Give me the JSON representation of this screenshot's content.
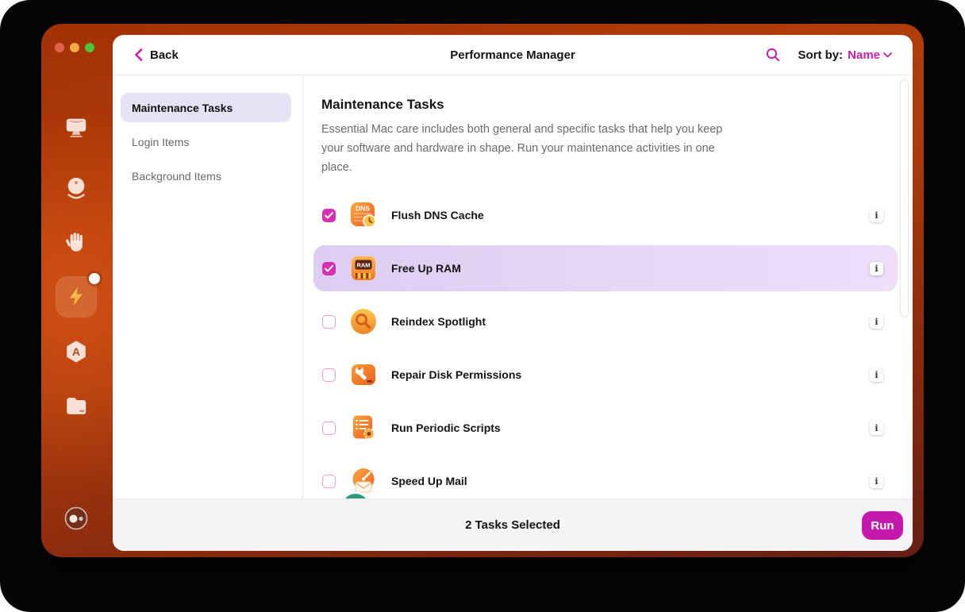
{
  "window": {
    "header": {
      "back_label": "Back",
      "title": "Performance Manager",
      "sort_by_label": "Sort by:",
      "sort_value": "Name"
    }
  },
  "sidebar": {
    "icons": [
      {
        "name": "cleanup-display-icon"
      },
      {
        "name": "smart-care-orb-icon"
      },
      {
        "name": "protection-hand-icon"
      },
      {
        "name": "performance-bolt-icon",
        "active": true,
        "has_notification": true
      },
      {
        "name": "applications-icon"
      },
      {
        "name": "my-clutter-folder-icon"
      },
      {
        "name": "assistant-icon"
      }
    ]
  },
  "nav": {
    "items": [
      {
        "label": "Maintenance Tasks",
        "active": true
      },
      {
        "label": "Login Items",
        "active": false
      },
      {
        "label": "Background Items",
        "active": false
      }
    ]
  },
  "main": {
    "heading": "Maintenance Tasks",
    "description": "Essential Mac care includes both general and specific tasks that help you keep your software and hardware in shape. Run your maintenance activities in one place.",
    "tasks": [
      {
        "label": "Flush DNS Cache",
        "checked": true,
        "highlighted": false,
        "icon": "dns-cache-icon"
      },
      {
        "label": "Free Up RAM",
        "checked": true,
        "highlighted": true,
        "icon": "ram-chip-icon"
      },
      {
        "label": "Reindex Spotlight",
        "checked": false,
        "highlighted": false,
        "icon": "spotlight-magnifier-icon"
      },
      {
        "label": "Repair Disk Permissions",
        "checked": false,
        "highlighted": false,
        "icon": "disk-wrench-icon"
      },
      {
        "label": "Run Periodic Scripts",
        "checked": false,
        "highlighted": false,
        "icon": "script-gear-icon"
      },
      {
        "label": "Speed Up Mail",
        "checked": false,
        "highlighted": false,
        "icon": "mail-speedometer-icon"
      }
    ]
  },
  "footer": {
    "status": "2 Tasks Selected",
    "run_label": "Run"
  },
  "colors": {
    "accent_magenta": "#cb1ead",
    "run_button": "#c519ae",
    "checked_checkbox": "#d62fb1",
    "highlight_row": "#e3d3f6",
    "nav_pill": "#e7e2f6",
    "frame_orange": "#aa3a0c",
    "frame_maroon": "#651f13",
    "footer_bg": "#f4f4f6"
  }
}
